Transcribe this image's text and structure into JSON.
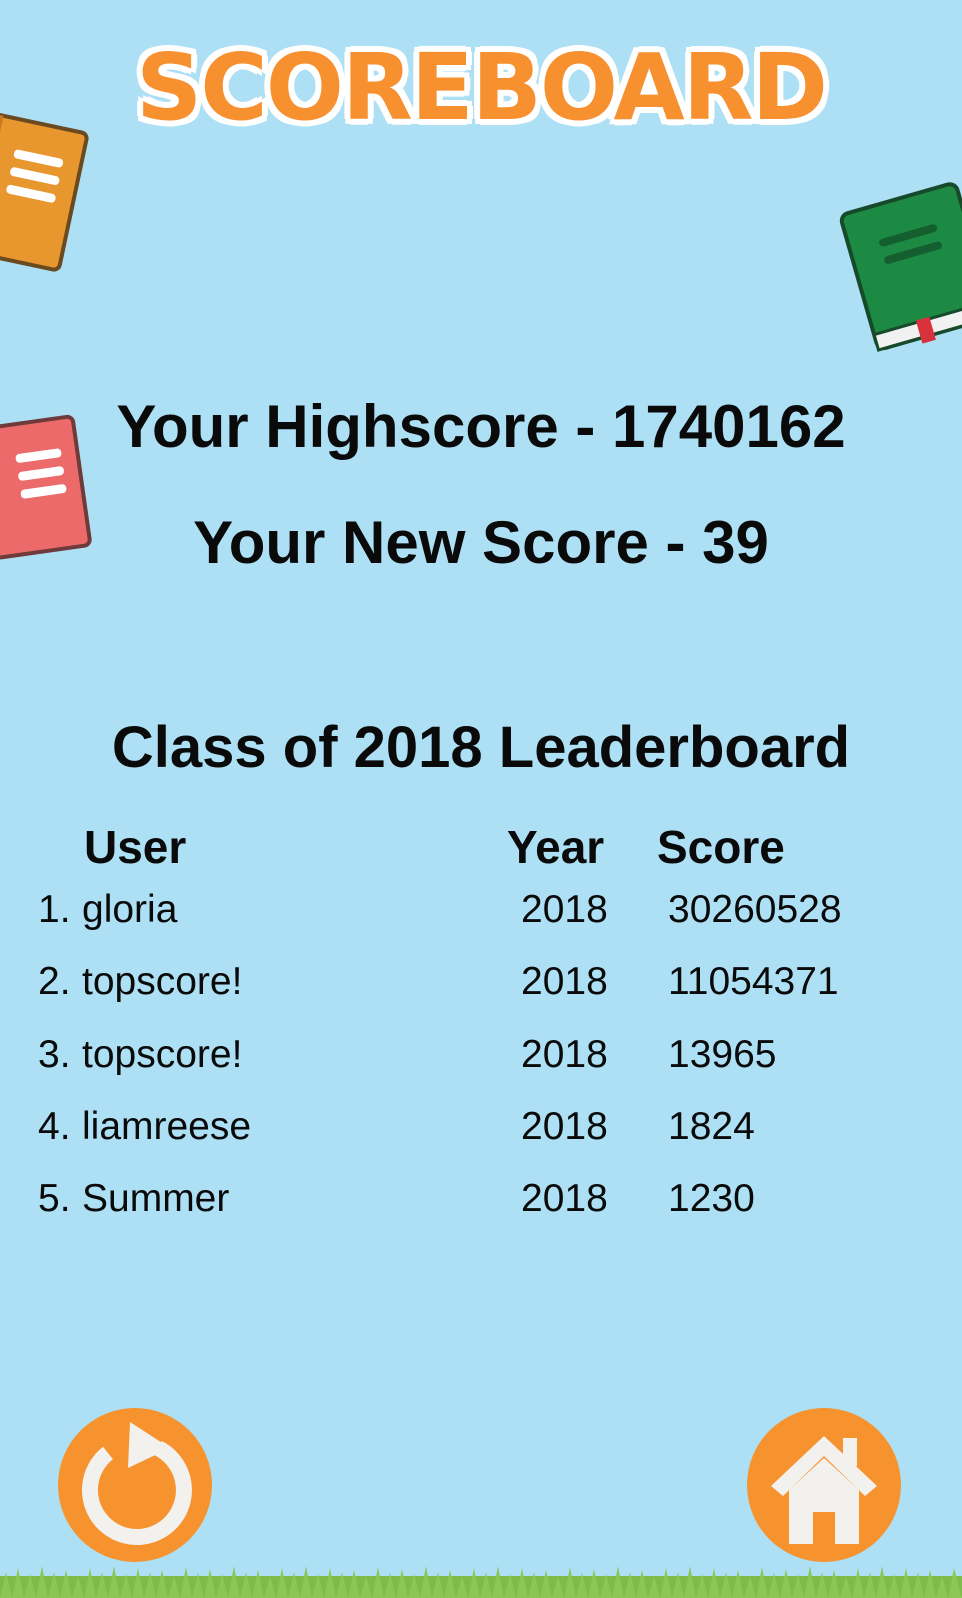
{
  "title": "SCOREBOARD",
  "scores": {
    "highscore_text": "Your Highscore - 1740162",
    "new_score_text": "Your New Score - 39"
  },
  "leaderboard": {
    "title": "Class of 2018 Leaderboard",
    "headers": {
      "user": "User",
      "year": "Year",
      "score": "Score"
    },
    "rows": [
      {
        "rank": "1.",
        "user": "gloria",
        "year": "2018",
        "score": "30260528"
      },
      {
        "rank": "2.",
        "user": "topscore!",
        "year": "2018",
        "score": "11054371"
      },
      {
        "rank": "3.",
        "user": "topscore!",
        "year": "2018",
        "score": "13965"
      },
      {
        "rank": "4.",
        "user": "liamreese",
        "year": "2018",
        "score": "1824"
      },
      {
        "rank": "5.",
        "user": "Summer",
        "year": "2018",
        "score": "1230"
      }
    ]
  },
  "buttons": {
    "restart_icon": "restart-icon",
    "home_icon": "home-icon"
  },
  "colors": {
    "background": "#ade0f4",
    "accent": "#f7902f",
    "book_orange": "#e8962e",
    "book_green": "#1d8a44",
    "book_red": "#ec6a6a",
    "grass": "#7dbb4a"
  }
}
